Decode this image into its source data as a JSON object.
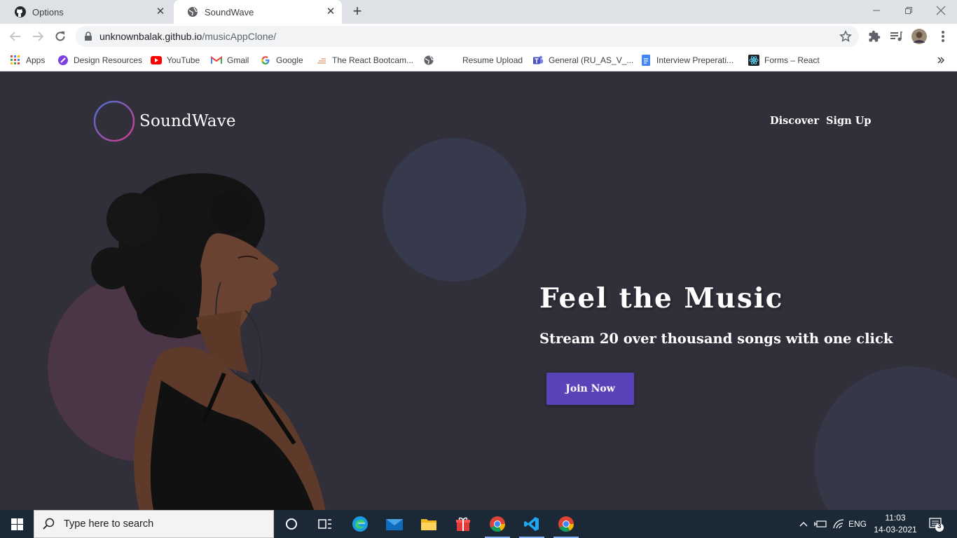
{
  "browser": {
    "tabs": [
      {
        "title": "Options",
        "icon": "github-icon",
        "active": false
      },
      {
        "title": "SoundWave",
        "icon": "globe-icon",
        "active": true
      }
    ],
    "url_host": "unknownbalak.github.io",
    "url_path": "/musicAppClone/",
    "bookmarks": [
      {
        "label": "Apps",
        "icon": "apps-grid-icon"
      },
      {
        "label": "Design Resources",
        "icon": "design-icon"
      },
      {
        "label": "YouTube",
        "icon": "youtube-icon"
      },
      {
        "label": "Gmail",
        "icon": "gmail-icon"
      },
      {
        "label": "Google",
        "icon": "google-icon"
      },
      {
        "label": "The React Bootcam...",
        "icon": "bootcamp-icon"
      },
      {
        "label": "",
        "icon": "globe-icon"
      },
      {
        "label": "Resume Upload",
        "icon": ""
      },
      {
        "label": "General (RU_AS_V_...",
        "icon": "teams-icon"
      },
      {
        "label": "Interview Preperati...",
        "icon": "docs-icon"
      },
      {
        "label": "Forms – React",
        "icon": "react-icon"
      }
    ]
  },
  "site": {
    "brand": "SoundWave",
    "nav": [
      "Discover",
      "Sign Up"
    ],
    "hero_title": "Feel the Music",
    "hero_subtitle": "Stream 20 over thousand songs with one click",
    "cta": "Join Now",
    "colors": {
      "background": "#302f3a",
      "button": "#5a42b8",
      "blob_left": "#4a3646",
      "blob_blue": "#363a4c"
    }
  },
  "taskbar": {
    "search_placeholder": "Type here to search",
    "language": "ENG",
    "time": "11:03",
    "date": "14-03-2021",
    "notifications": "3"
  }
}
